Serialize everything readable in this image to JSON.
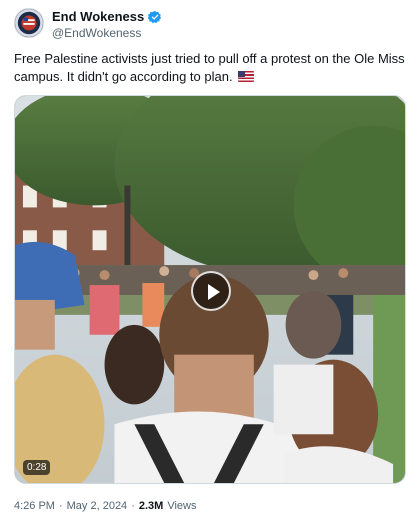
{
  "author": {
    "display_name": "End Wokeness",
    "handle": "@EndWokeness",
    "verified_icon": "verified-badge-icon",
    "avatar_icon": "seal-logo"
  },
  "tweet": {
    "text": "Free Palestine activists just tried to pull off a protest on the Ole Miss campus. It didn't go according to plan.",
    "flag_icon": "us-flag-emoji"
  },
  "video": {
    "duration": "0:28",
    "play_icon": "play-icon"
  },
  "meta": {
    "time": "4:26 PM",
    "separator": "·",
    "date": "May 2, 2024",
    "separator2": "·",
    "views_count": "2.3M",
    "views_label": "Views"
  },
  "colors": {
    "verified": "#1d9bf0",
    "text": "#0f1419",
    "secondary": "#536471"
  }
}
